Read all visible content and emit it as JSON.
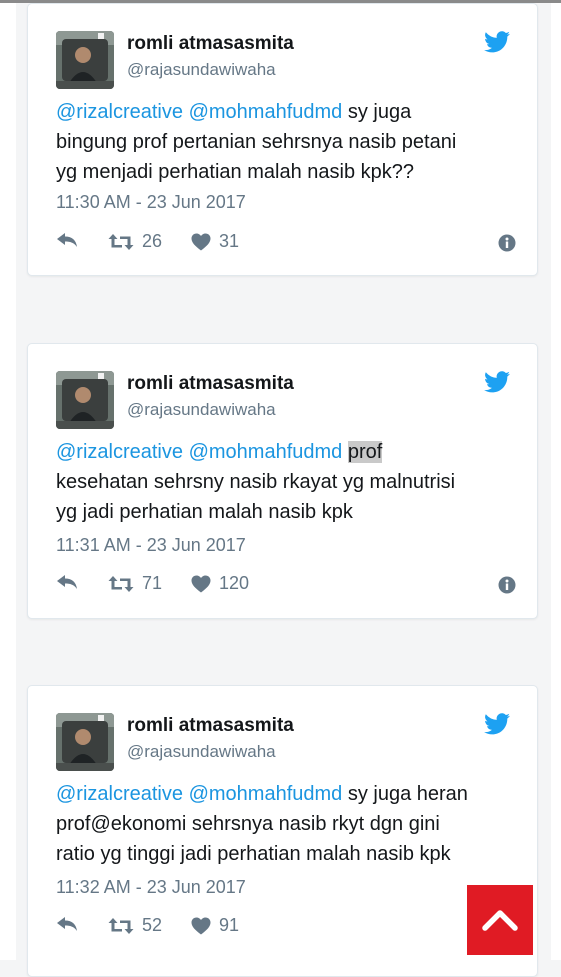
{
  "accent_color": "#1b95e0",
  "tweets": [
    {
      "name": "romli atmasasmita",
      "handle": "@rajasundawiwaha",
      "mentions": [
        "@rizalcreative",
        "@mohmahfudmd"
      ],
      "lines": [
        "sy juga",
        "bingung prof pertanian sehrsnya nasib petani",
        "yg menjadi perhatian malah nasib kpk??"
      ],
      "timestamp": "11:30 AM - 23 Jun 2017",
      "retweets": "26",
      "likes": "31"
    },
    {
      "name": "romli atmasasmita",
      "handle": "@rajasundawiwaha",
      "mentions": [
        "@rizalcreative",
        "@mohmahfudmd"
      ],
      "highlight": "prof",
      "lines": [
        "",
        "kesehatan sehrsny nasib rkayat yg malnutrisi",
        "yg jadi perhatian malah nasib kpk"
      ],
      "timestamp": "11:31 AM - 23 Jun 2017",
      "retweets": "71",
      "likes": "120"
    },
    {
      "name": "romli atmasasmita",
      "handle": "@rajasundawiwaha",
      "mentions": [
        "@rizalcreative",
        "@mohmahfudmd"
      ],
      "lines": [
        "sy juga heran",
        "prof@ekonomi sehrsnya nasib rkyt dgn gini",
        "ratio yg tinggi jadi perhatian malah nasib kpk"
      ],
      "timestamp": "11:32 AM - 23 Jun 2017",
      "retweets": "52",
      "likes": "91"
    }
  ],
  "icons": {
    "reply": "reply-icon",
    "retweet": "retweet-icon",
    "like": "heart-icon",
    "info": "info-icon",
    "brand": "twitter-bird-icon",
    "scroll_top": "chevron-up-icon"
  }
}
